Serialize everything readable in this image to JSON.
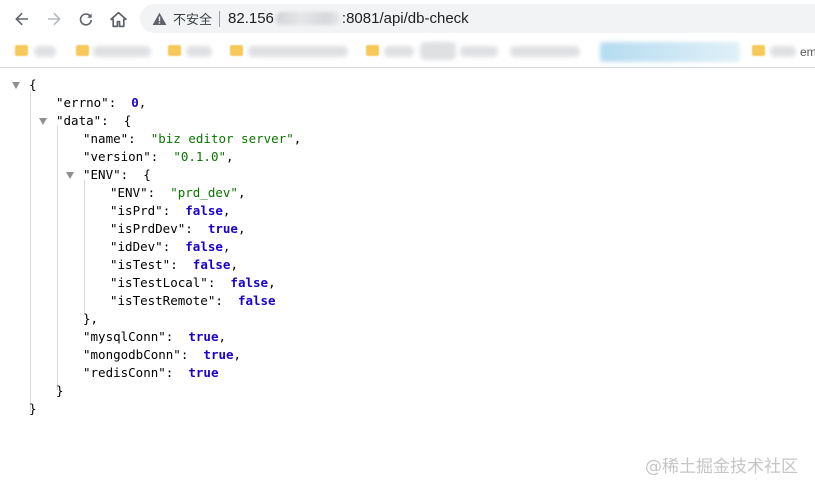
{
  "toolbar": {
    "icons": [
      "back-icon",
      "forward-icon",
      "reload-icon",
      "home-icon"
    ],
    "security_label": "不安全",
    "url_prefix": "82.156",
    "url_suffix": ":8081/api/db-check"
  },
  "bookmarks": {
    "tail_text": "em"
  },
  "json": {
    "open_root": "{",
    "errno_key": "\"errno\"",
    "errno_value": "0",
    "data_key": "\"data\"",
    "name_key": "\"name\"",
    "name_value": "\"biz editor server\"",
    "version_key": "\"version\"",
    "version_value": "\"0.1.0\"",
    "env_key": "\"ENV\"",
    "env_env_key": "\"ENV\"",
    "env_env_value": "\"prd_dev\"",
    "isPrd_key": "\"isPrd\"",
    "isPrd_value": "false",
    "isPrdDev_key": "\"isPrdDev\"",
    "isPrdDev_value": "true",
    "idDev_key": "\"idDev\"",
    "idDev_value": "false",
    "isTest_key": "\"isTest\"",
    "isTest_value": "false",
    "isTestLocal_key": "\"isTestLocal\"",
    "isTestLocal_value": "false",
    "isTestRemote_key": "\"isTestRemote\"",
    "isTestRemote_value": "false",
    "close_env": "},",
    "mysqlConn_key": "\"mysqlConn\"",
    "mysqlConn_value": "true",
    "mongodbConn_key": "\"mongodbConn\"",
    "mongodbConn_value": "true",
    "redisConn_key": "\"redisConn\"",
    "redisConn_value": "true",
    "close_data": "}",
    "close_root": "}"
  },
  "watermark": "@稀土掘金技术社区",
  "colors": {
    "key": "#000000",
    "string": "#0b7500",
    "literal": "#1a01cc",
    "warning_icon": "#5f6368"
  }
}
